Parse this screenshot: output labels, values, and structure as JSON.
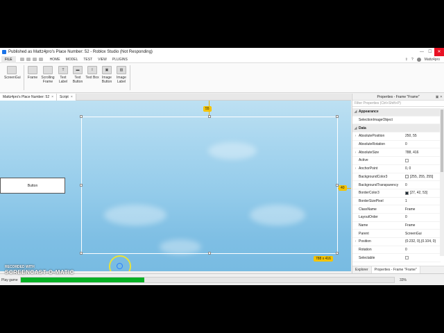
{
  "window": {
    "title": "Published as Mattz4pro's Place Number: 52 - Roblox Studio (Not Responding)",
    "minimize": "—",
    "maximize": "☐",
    "close": "✕"
  },
  "menubar": {
    "file": "FILE",
    "tabs": [
      "HOME",
      "MODEL",
      "TEST",
      "VIEW",
      "PLUGINS"
    ],
    "username": "Mattz4pro"
  },
  "ribbon": {
    "buttons": [
      {
        "label": "ScreenGui",
        "icon": "screengui-icon"
      },
      {
        "label": "Frame",
        "icon": "frame-icon"
      },
      {
        "label": "Scrolling Frame",
        "icon": "scrolling-frame-icon"
      },
      {
        "label": "Text Label",
        "icon": "text-label-icon"
      },
      {
        "label": "Text Button",
        "icon": "text-button-icon"
      },
      {
        "label": "Text Box",
        "icon": "text-box-icon"
      },
      {
        "label": "Image Button",
        "icon": "image-button-icon"
      },
      {
        "label": "Image Label",
        "icon": "image-label-icon"
      }
    ]
  },
  "doctabs": [
    {
      "label": "Mattz4pro's Place Number: 52",
      "close": "×"
    },
    {
      "label": "Script",
      "close": "×"
    }
  ],
  "viewport": {
    "button_text": "Button",
    "top_offset_tag": "55",
    "right_offset_tag": "40",
    "size_tag": "788 x 416"
  },
  "properties": {
    "title": "Properties - Frame \"Frame\"",
    "filter_placeholder": "Filter Properties (Ctrl+Shift+P)",
    "rows": [
      {
        "type": "section",
        "name": "Appearance"
      },
      {
        "name": "SelectionImageObject",
        "value": ""
      },
      {
        "type": "section",
        "name": "Data"
      },
      {
        "name": "AbsolutePosition",
        "value": "250, 55",
        "expand": true
      },
      {
        "name": "AbsoluteRotation",
        "value": "0"
      },
      {
        "name": "AbsoluteSize",
        "value": "788, 416",
        "expand": true
      },
      {
        "name": "Active",
        "value": "",
        "check": true
      },
      {
        "name": "AnchorPoint",
        "value": "0, 0",
        "expand": true
      },
      {
        "name": "BackgroundColor3",
        "value": "[255, 255, 255]",
        "swatch": "#ffffff"
      },
      {
        "name": "BackgroundTransparency",
        "value": "0"
      },
      {
        "name": "BorderColor3",
        "value": "[27, 42, 53]",
        "swatch": "#1b2a35"
      },
      {
        "name": "BorderSizePixel",
        "value": "1"
      },
      {
        "name": "ClassName",
        "value": "Frame"
      },
      {
        "name": "LayoutOrder",
        "value": "0"
      },
      {
        "name": "Name",
        "value": "Frame"
      },
      {
        "name": "Parent",
        "value": "ScreenGui"
      },
      {
        "name": "Position",
        "value": "{0.232, 0},{0.104, 0}",
        "expand": true
      },
      {
        "name": "Rotation",
        "value": "0"
      },
      {
        "name": "Selectable",
        "value": "",
        "check": true
      }
    ],
    "tabs": [
      "Explorer",
      "Properties - Frame \"Frame\""
    ]
  },
  "status": {
    "label": "Play game",
    "progress": 0.33,
    "percent_text": "33%",
    "fill_color": "#06b025"
  },
  "watermark": {
    "line1": "RECORDED WITH",
    "line2": "SCREENCAST-O-MATIC"
  }
}
